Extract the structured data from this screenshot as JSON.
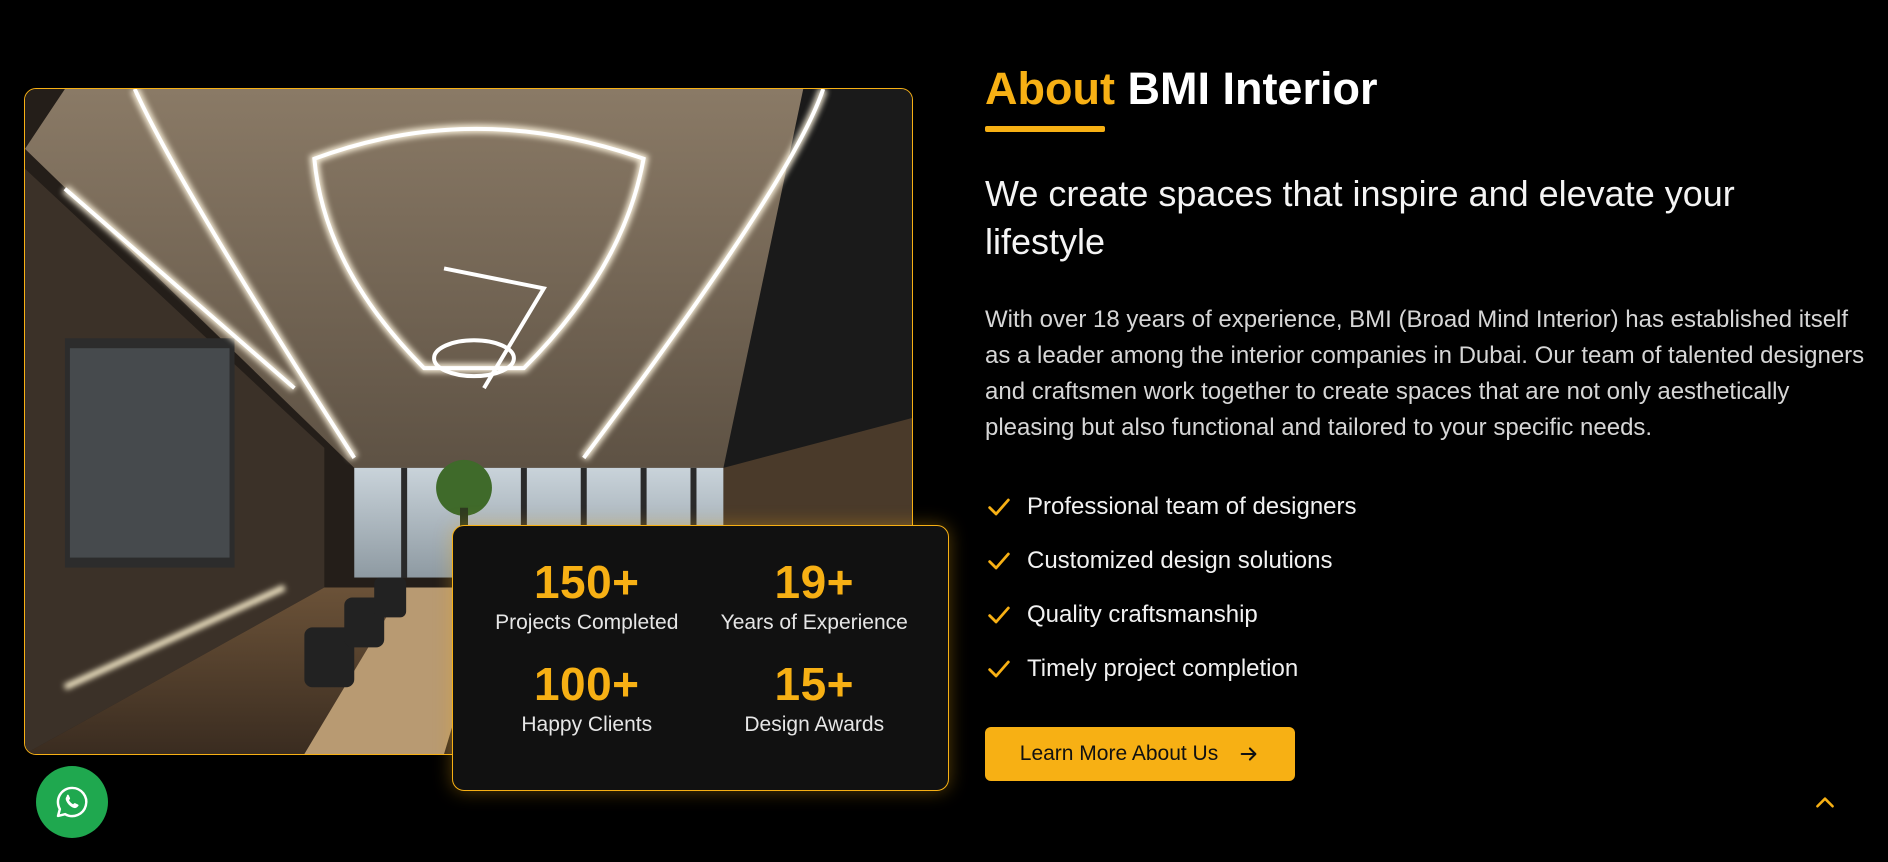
{
  "about": {
    "title_accent": "About",
    "title_rest": "BMI Interior",
    "subtitle": "We create spaces that inspire and elevate your lifestyle",
    "description": "With over 18 years of experience, BMI (Broad Mind Interior) has established itself as a leader among the interior companies in Dubai. Our team of talented designers and craftsmen work together to create spaces that are not only aesthetically pleasing but also functional and tailored to your specific needs.",
    "features": [
      "Professional team of designers",
      "Customized design solutions",
      "Quality craftsmanship",
      "Timely project completion"
    ],
    "cta_label": "Learn More About Us"
  },
  "stats": [
    {
      "value": "150+",
      "label": "Projects Completed"
    },
    {
      "value": "19+",
      "label": "Years of Experience"
    },
    {
      "value": "100+",
      "label": "Happy Clients"
    },
    {
      "value": "15+",
      "label": "Design Awards"
    }
  ],
  "icons": {
    "feature": "check-icon",
    "cta": "arrow-right-icon",
    "whatsapp": "whatsapp-icon",
    "scroll_top": "chevron-up-icon"
  },
  "colors": {
    "accent": "#f7b014",
    "background": "#000000",
    "card": "#111111",
    "whatsapp": "#1fa84f"
  }
}
